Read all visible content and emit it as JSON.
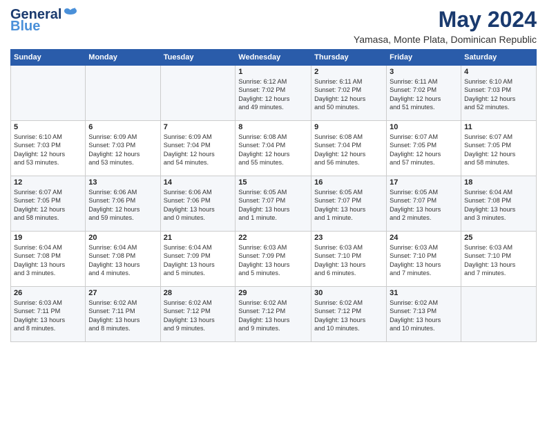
{
  "header": {
    "logo_general": "General",
    "logo_blue": "Blue",
    "month": "May 2024",
    "location": "Yamasa, Monte Plata, Dominican Republic"
  },
  "days_of_week": [
    "Sunday",
    "Monday",
    "Tuesday",
    "Wednesday",
    "Thursday",
    "Friday",
    "Saturday"
  ],
  "weeks": [
    [
      {
        "day": "",
        "info": ""
      },
      {
        "day": "",
        "info": ""
      },
      {
        "day": "",
        "info": ""
      },
      {
        "day": "1",
        "info": "Sunrise: 6:12 AM\nSunset: 7:02 PM\nDaylight: 12 hours\nand 49 minutes."
      },
      {
        "day": "2",
        "info": "Sunrise: 6:11 AM\nSunset: 7:02 PM\nDaylight: 12 hours\nand 50 minutes."
      },
      {
        "day": "3",
        "info": "Sunrise: 6:11 AM\nSunset: 7:02 PM\nDaylight: 12 hours\nand 51 minutes."
      },
      {
        "day": "4",
        "info": "Sunrise: 6:10 AM\nSunset: 7:03 PM\nDaylight: 12 hours\nand 52 minutes."
      }
    ],
    [
      {
        "day": "5",
        "info": "Sunrise: 6:10 AM\nSunset: 7:03 PM\nDaylight: 12 hours\nand 53 minutes."
      },
      {
        "day": "6",
        "info": "Sunrise: 6:09 AM\nSunset: 7:03 PM\nDaylight: 12 hours\nand 53 minutes."
      },
      {
        "day": "7",
        "info": "Sunrise: 6:09 AM\nSunset: 7:04 PM\nDaylight: 12 hours\nand 54 minutes."
      },
      {
        "day": "8",
        "info": "Sunrise: 6:08 AM\nSunset: 7:04 PM\nDaylight: 12 hours\nand 55 minutes."
      },
      {
        "day": "9",
        "info": "Sunrise: 6:08 AM\nSunset: 7:04 PM\nDaylight: 12 hours\nand 56 minutes."
      },
      {
        "day": "10",
        "info": "Sunrise: 6:07 AM\nSunset: 7:05 PM\nDaylight: 12 hours\nand 57 minutes."
      },
      {
        "day": "11",
        "info": "Sunrise: 6:07 AM\nSunset: 7:05 PM\nDaylight: 12 hours\nand 58 minutes."
      }
    ],
    [
      {
        "day": "12",
        "info": "Sunrise: 6:07 AM\nSunset: 7:05 PM\nDaylight: 12 hours\nand 58 minutes."
      },
      {
        "day": "13",
        "info": "Sunrise: 6:06 AM\nSunset: 7:06 PM\nDaylight: 12 hours\nand 59 minutes."
      },
      {
        "day": "14",
        "info": "Sunrise: 6:06 AM\nSunset: 7:06 PM\nDaylight: 13 hours\nand 0 minutes."
      },
      {
        "day": "15",
        "info": "Sunrise: 6:05 AM\nSunset: 7:07 PM\nDaylight: 13 hours\nand 1 minute."
      },
      {
        "day": "16",
        "info": "Sunrise: 6:05 AM\nSunset: 7:07 PM\nDaylight: 13 hours\nand 1 minute."
      },
      {
        "day": "17",
        "info": "Sunrise: 6:05 AM\nSunset: 7:07 PM\nDaylight: 13 hours\nand 2 minutes."
      },
      {
        "day": "18",
        "info": "Sunrise: 6:04 AM\nSunset: 7:08 PM\nDaylight: 13 hours\nand 3 minutes."
      }
    ],
    [
      {
        "day": "19",
        "info": "Sunrise: 6:04 AM\nSunset: 7:08 PM\nDaylight: 13 hours\nand 3 minutes."
      },
      {
        "day": "20",
        "info": "Sunrise: 6:04 AM\nSunset: 7:08 PM\nDaylight: 13 hours\nand 4 minutes."
      },
      {
        "day": "21",
        "info": "Sunrise: 6:04 AM\nSunset: 7:09 PM\nDaylight: 13 hours\nand 5 minutes."
      },
      {
        "day": "22",
        "info": "Sunrise: 6:03 AM\nSunset: 7:09 PM\nDaylight: 13 hours\nand 5 minutes."
      },
      {
        "day": "23",
        "info": "Sunrise: 6:03 AM\nSunset: 7:10 PM\nDaylight: 13 hours\nand 6 minutes."
      },
      {
        "day": "24",
        "info": "Sunrise: 6:03 AM\nSunset: 7:10 PM\nDaylight: 13 hours\nand 7 minutes."
      },
      {
        "day": "25",
        "info": "Sunrise: 6:03 AM\nSunset: 7:10 PM\nDaylight: 13 hours\nand 7 minutes."
      }
    ],
    [
      {
        "day": "26",
        "info": "Sunrise: 6:03 AM\nSunset: 7:11 PM\nDaylight: 13 hours\nand 8 minutes."
      },
      {
        "day": "27",
        "info": "Sunrise: 6:02 AM\nSunset: 7:11 PM\nDaylight: 13 hours\nand 8 minutes."
      },
      {
        "day": "28",
        "info": "Sunrise: 6:02 AM\nSunset: 7:12 PM\nDaylight: 13 hours\nand 9 minutes."
      },
      {
        "day": "29",
        "info": "Sunrise: 6:02 AM\nSunset: 7:12 PM\nDaylight: 13 hours\nand 9 minutes."
      },
      {
        "day": "30",
        "info": "Sunrise: 6:02 AM\nSunset: 7:12 PM\nDaylight: 13 hours\nand 10 minutes."
      },
      {
        "day": "31",
        "info": "Sunrise: 6:02 AM\nSunset: 7:13 PM\nDaylight: 13 hours\nand 10 minutes."
      },
      {
        "day": "",
        "info": ""
      }
    ]
  ]
}
